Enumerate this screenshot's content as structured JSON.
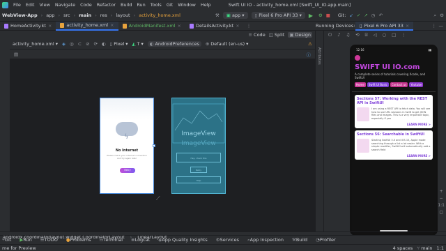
{
  "menubar": {
    "items": [
      "File",
      "Edit",
      "View",
      "Navigate",
      "Code",
      "Refactor",
      "Build",
      "Run",
      "Tools",
      "Git",
      "Window",
      "Help"
    ],
    "title": "Swift UI IO - activity_home.xml [Swift_UI_IO.app.main]"
  },
  "navbar": {
    "project": "WebView-App",
    "crumbs": [
      "app",
      "src",
      "main",
      "res",
      "layout"
    ],
    "file": "activity_home.xml",
    "module": "app",
    "device": "Pixel 6 Pro API 33",
    "git": "Git:"
  },
  "tabs": [
    {
      "label": "HomeActivity.kt",
      "active": false,
      "color": "#a97bff"
    },
    {
      "label": "activity_home.xml",
      "active": true,
      "color": "#e8a33d"
    },
    {
      "label": "AndroidManifest.xml",
      "active": false,
      "color": "#e8a33d"
    },
    {
      "label": "DetailsActivity.kt",
      "active": false,
      "color": "#a97bff"
    }
  ],
  "view_modes": [
    "Code",
    "Split",
    "Design"
  ],
  "design_bar": {
    "file": "activity_home.xml",
    "device": "Pixel",
    "api": "T",
    "theme": "AndroidPreferences",
    "locale": "Default (en-us)"
  },
  "preview": {
    "no_internet": "No Internet",
    "msg": "Please check your internet connection and try again later",
    "retry": "Retry",
    "blueprint_label": "ImageView",
    "blueprint_label2": "ImageView",
    "bp_text": "Hey, check this",
    "bp_btn": "Retry",
    "bp_foot": "Help"
  },
  "run_panel": {
    "title": "Running Devices:",
    "device": "Pixel 6 Pro API 33"
  },
  "app": {
    "time": "12:16",
    "title": "SWIFT UI IO.com",
    "subtitle": "A complete series of tutorials covering Xcode, and SwiftUI",
    "buttons": [
      {
        "label": "Home",
        "color": "#d0389a"
      },
      {
        "label": "Swift UI Basic",
        "color": "#7e3fd8"
      },
      {
        "label": "Contact us",
        "color": "#c6348e"
      },
      {
        "label": "Youtube",
        "color": "#8d38d0"
      }
    ],
    "cards": [
      {
        "title": "Sections 57: Working with the REST API in SwiftUI",
        "body": "I am using a REST API to fetch data. You will see how to use URL sessions in Swift to get JSON files and images. This is a very important topic, especially if you",
        "more": "LEARN MORE >"
      },
      {
        "title": "Sections 56: Searchable in SwiftUI",
        "body": "Starting SwiftUI 3.0 and iOS 15, Apple made searching through a list a lot easier. With a simple modifier, SwiftUI will automatically add a search field",
        "more": "LEARN MORE >"
      }
    ]
  },
  "statusline": {
    "path": [
      "androidx.coordinatorlayout.widget.CoordinatorLayout",
      "LinearLayout"
    ]
  },
  "toolwindows": [
    "Git",
    "Run",
    "TODO",
    "Problems",
    "Terminal",
    "Logcat",
    "App Quality Insights",
    "Services",
    "App Inspection",
    "Build",
    "Profiler"
  ],
  "bottom": {
    "left": "me for Preview",
    "right": [
      "4 spaces",
      "main",
      "1:1"
    ]
  }
}
